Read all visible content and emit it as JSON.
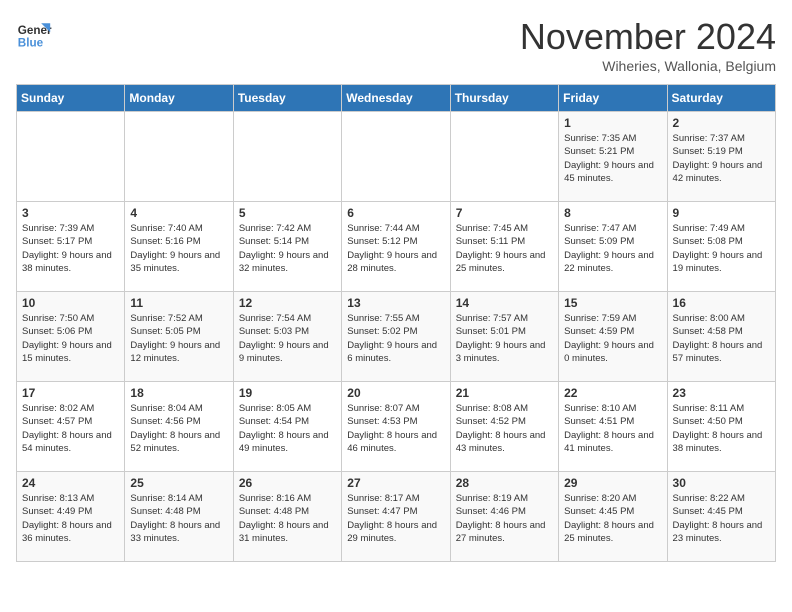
{
  "logo": {
    "line1": "General",
    "line2": "Blue"
  },
  "title": "November 2024",
  "subtitle": "Wiheries, Wallonia, Belgium",
  "days_of_week": [
    "Sunday",
    "Monday",
    "Tuesday",
    "Wednesday",
    "Thursday",
    "Friday",
    "Saturday"
  ],
  "weeks": [
    [
      {
        "day": "",
        "info": ""
      },
      {
        "day": "",
        "info": ""
      },
      {
        "day": "",
        "info": ""
      },
      {
        "day": "",
        "info": ""
      },
      {
        "day": "",
        "info": ""
      },
      {
        "day": "1",
        "info": "Sunrise: 7:35 AM\nSunset: 5:21 PM\nDaylight: 9 hours and 45 minutes."
      },
      {
        "day": "2",
        "info": "Sunrise: 7:37 AM\nSunset: 5:19 PM\nDaylight: 9 hours and 42 minutes."
      }
    ],
    [
      {
        "day": "3",
        "info": "Sunrise: 7:39 AM\nSunset: 5:17 PM\nDaylight: 9 hours and 38 minutes."
      },
      {
        "day": "4",
        "info": "Sunrise: 7:40 AM\nSunset: 5:16 PM\nDaylight: 9 hours and 35 minutes."
      },
      {
        "day": "5",
        "info": "Sunrise: 7:42 AM\nSunset: 5:14 PM\nDaylight: 9 hours and 32 minutes."
      },
      {
        "day": "6",
        "info": "Sunrise: 7:44 AM\nSunset: 5:12 PM\nDaylight: 9 hours and 28 minutes."
      },
      {
        "day": "7",
        "info": "Sunrise: 7:45 AM\nSunset: 5:11 PM\nDaylight: 9 hours and 25 minutes."
      },
      {
        "day": "8",
        "info": "Sunrise: 7:47 AM\nSunset: 5:09 PM\nDaylight: 9 hours and 22 minutes."
      },
      {
        "day": "9",
        "info": "Sunrise: 7:49 AM\nSunset: 5:08 PM\nDaylight: 9 hours and 19 minutes."
      }
    ],
    [
      {
        "day": "10",
        "info": "Sunrise: 7:50 AM\nSunset: 5:06 PM\nDaylight: 9 hours and 15 minutes."
      },
      {
        "day": "11",
        "info": "Sunrise: 7:52 AM\nSunset: 5:05 PM\nDaylight: 9 hours and 12 minutes."
      },
      {
        "day": "12",
        "info": "Sunrise: 7:54 AM\nSunset: 5:03 PM\nDaylight: 9 hours and 9 minutes."
      },
      {
        "day": "13",
        "info": "Sunrise: 7:55 AM\nSunset: 5:02 PM\nDaylight: 9 hours and 6 minutes."
      },
      {
        "day": "14",
        "info": "Sunrise: 7:57 AM\nSunset: 5:01 PM\nDaylight: 9 hours and 3 minutes."
      },
      {
        "day": "15",
        "info": "Sunrise: 7:59 AM\nSunset: 4:59 PM\nDaylight: 9 hours and 0 minutes."
      },
      {
        "day": "16",
        "info": "Sunrise: 8:00 AM\nSunset: 4:58 PM\nDaylight: 8 hours and 57 minutes."
      }
    ],
    [
      {
        "day": "17",
        "info": "Sunrise: 8:02 AM\nSunset: 4:57 PM\nDaylight: 8 hours and 54 minutes."
      },
      {
        "day": "18",
        "info": "Sunrise: 8:04 AM\nSunset: 4:56 PM\nDaylight: 8 hours and 52 minutes."
      },
      {
        "day": "19",
        "info": "Sunrise: 8:05 AM\nSunset: 4:54 PM\nDaylight: 8 hours and 49 minutes."
      },
      {
        "day": "20",
        "info": "Sunrise: 8:07 AM\nSunset: 4:53 PM\nDaylight: 8 hours and 46 minutes."
      },
      {
        "day": "21",
        "info": "Sunrise: 8:08 AM\nSunset: 4:52 PM\nDaylight: 8 hours and 43 minutes."
      },
      {
        "day": "22",
        "info": "Sunrise: 8:10 AM\nSunset: 4:51 PM\nDaylight: 8 hours and 41 minutes."
      },
      {
        "day": "23",
        "info": "Sunrise: 8:11 AM\nSunset: 4:50 PM\nDaylight: 8 hours and 38 minutes."
      }
    ],
    [
      {
        "day": "24",
        "info": "Sunrise: 8:13 AM\nSunset: 4:49 PM\nDaylight: 8 hours and 36 minutes."
      },
      {
        "day": "25",
        "info": "Sunrise: 8:14 AM\nSunset: 4:48 PM\nDaylight: 8 hours and 33 minutes."
      },
      {
        "day": "26",
        "info": "Sunrise: 8:16 AM\nSunset: 4:48 PM\nDaylight: 8 hours and 31 minutes."
      },
      {
        "day": "27",
        "info": "Sunrise: 8:17 AM\nSunset: 4:47 PM\nDaylight: 8 hours and 29 minutes."
      },
      {
        "day": "28",
        "info": "Sunrise: 8:19 AM\nSunset: 4:46 PM\nDaylight: 8 hours and 27 minutes."
      },
      {
        "day": "29",
        "info": "Sunrise: 8:20 AM\nSunset: 4:45 PM\nDaylight: 8 hours and 25 minutes."
      },
      {
        "day": "30",
        "info": "Sunrise: 8:22 AM\nSunset: 4:45 PM\nDaylight: 8 hours and 23 minutes."
      }
    ]
  ]
}
